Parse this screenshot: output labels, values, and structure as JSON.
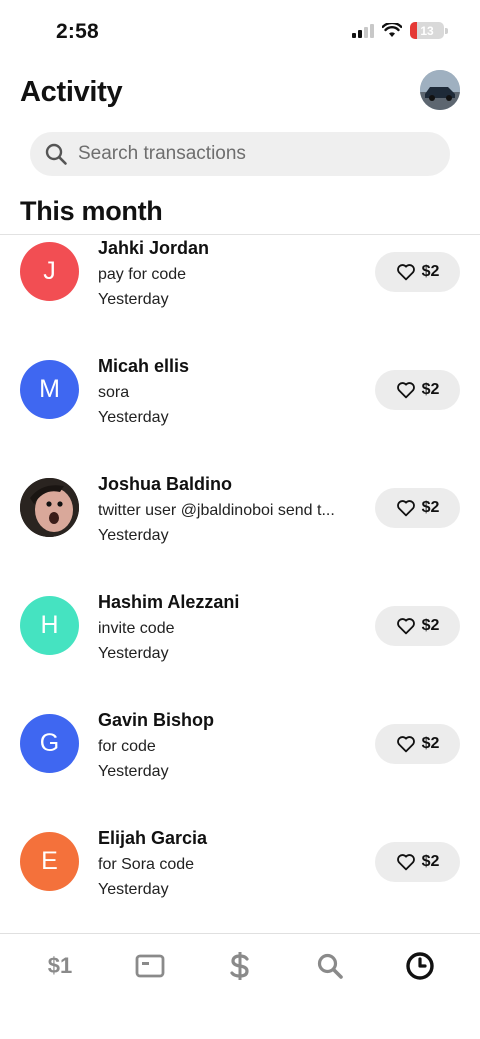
{
  "status_bar": {
    "time": "2:58",
    "battery": "13"
  },
  "header": {
    "title": "Activity"
  },
  "search": {
    "placeholder": "Search transactions"
  },
  "section": {
    "title": "This month"
  },
  "transactions": [
    {
      "initial": "J",
      "color": "#f24e53",
      "name": "Jahki Jordan",
      "note": "pay for code",
      "date": "Yesterday",
      "amount": "$2"
    },
    {
      "initial": "M",
      "color": "#3f67f1",
      "name": "Micah ellis",
      "note": "sora",
      "date": "Yesterday",
      "amount": "$2"
    },
    {
      "initial": "",
      "color": "#2a2420",
      "name": "Joshua Baldino",
      "note": "twitter user @jbaldinoboi send t...",
      "date": "Yesterday",
      "amount": "$2"
    },
    {
      "initial": "H",
      "color": "#45e3c1",
      "name": "Hashim Alezzani",
      "note": "invite code",
      "date": "Yesterday",
      "amount": "$2"
    },
    {
      "initial": "G",
      "color": "#3f67f1",
      "name": "Gavin Bishop",
      "note": "for code",
      "date": "Yesterday",
      "amount": "$2"
    },
    {
      "initial": "E",
      "color": "#f4713b",
      "name": "Elijah Garcia",
      "note": "for Sora code",
      "date": "Yesterday",
      "amount": "$2"
    }
  ],
  "tabbar": {
    "money_label": "$1",
    "active_color": "#111111",
    "inactive_color": "#8a8a8a"
  }
}
